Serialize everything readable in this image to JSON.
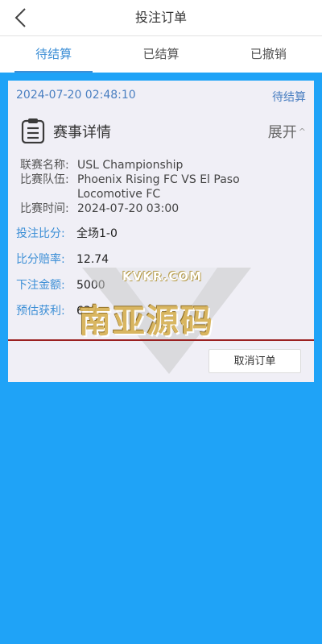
{
  "header": {
    "title": "投注订单",
    "back_icon": "chevron-left-icon"
  },
  "tabs": [
    {
      "label": "待结算",
      "active": true
    },
    {
      "label": "已结算",
      "active": false
    },
    {
      "label": "已撤销",
      "active": false
    }
  ],
  "order": {
    "time": "2024-07-20 02:48:10",
    "status": "待结算",
    "detail_title": "赛事详情",
    "detail_icon": "clipboard-icon",
    "expand_label": "展开",
    "expand_icon": "^",
    "info": [
      {
        "label": "联赛名称:",
        "value": "USL Championship"
      },
      {
        "label": "比赛队伍:",
        "value": "Phoenix Rising FC VS El Paso Locomotive FC"
      },
      {
        "label": "比赛时间:",
        "value": "2024-07-20 03:00"
      }
    ],
    "bet": [
      {
        "label": "投注比分:",
        "value": "全场1-0"
      },
      {
        "label": "比分赔率:",
        "value": "12.74"
      },
      {
        "label": "下注金额:",
        "value": "5000"
      },
      {
        "label": "预估获利:",
        "value": "637"
      }
    ],
    "cancel_label": "取消订单"
  },
  "watermark": {
    "small_text": "KVKR.COM",
    "big_text": "南亚源码"
  },
  "colors": {
    "background": "#1fa3f7",
    "accent": "#3d8fd6",
    "card": "#f0eff6",
    "divider": "#9b2020"
  }
}
